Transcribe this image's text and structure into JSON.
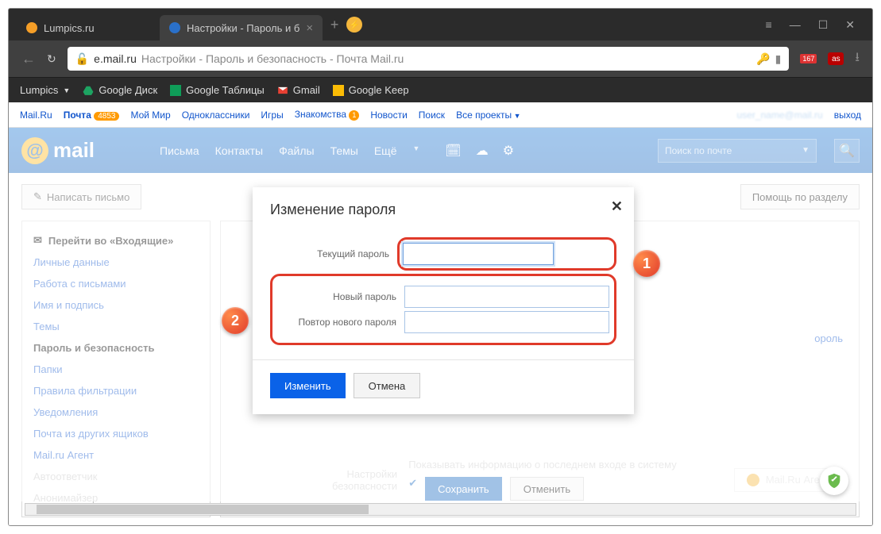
{
  "tabs": [
    {
      "title": "Lumpics.ru",
      "active": false
    },
    {
      "title": "Настройки - Пароль и б",
      "active": true
    }
  ],
  "url": {
    "host": "e.mail.ru",
    "path": "Настройки - Пароль и безопасность - Почта Mail.ru"
  },
  "addr_badge": "167",
  "bookmarks": [
    {
      "label": "Lumpics",
      "has_arrow": true
    },
    {
      "label": "Google Диск",
      "icon": "drive"
    },
    {
      "label": "Google Таблицы",
      "icon": "sheets"
    },
    {
      "label": "Gmail",
      "icon": "gmail"
    },
    {
      "label": "Google Keep",
      "icon": "keep"
    }
  ],
  "mailru_bar": {
    "items": [
      "Mail.Ru",
      "Почта",
      "Мой Мир",
      "Одноклассники",
      "Игры",
      "Знакомства",
      "Новости",
      "Поиск",
      "Все проекты"
    ],
    "mail_count": "4853",
    "zn_badge": "1",
    "exit": "выход"
  },
  "mail_header": {
    "logo_text": "mail",
    "nav": [
      "Письма",
      "Контакты",
      "Файлы",
      "Темы",
      "Ещё"
    ],
    "search_placeholder": "Поиск по почте"
  },
  "compose": "Написать письмо",
  "help": "Помощь по разделу",
  "sidebar": {
    "inbox": "Перейти во «Входящие»",
    "items": [
      "Личные данные",
      "Работа с письмами",
      "Имя и подпись",
      "Темы",
      "Пароль и безопасность",
      "Папки",
      "Правила фильтрации",
      "Уведомления",
      "Почта из других ящиков",
      "Mail.ru Агент",
      "Автоответчик",
      "Анонимайзер"
    ],
    "active_index": 4
  },
  "right": {
    "link": "ороль",
    "bottom_label1": "Настройки",
    "bottom_label2": "безопасности",
    "bottom_check": "Показывать информацию о последнем входе в систему",
    "save": "Сохранить",
    "cancel": "Отменить",
    "agent": "Mail.Ru Агент"
  },
  "modal": {
    "title": "Изменение пароля",
    "f1": "Текущий пароль",
    "f2": "Новый пароль",
    "f3": "Повтор нового пароля",
    "submit": "Изменить",
    "cancel": "Отмена"
  },
  "callouts": {
    "c1": "1",
    "c2": "2"
  }
}
